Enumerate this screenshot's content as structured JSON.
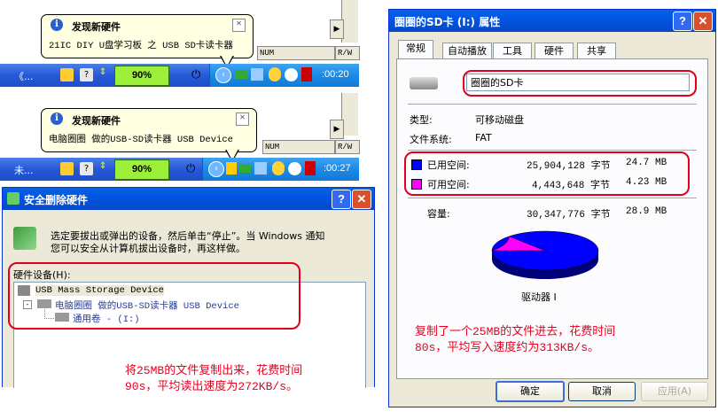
{
  "balloon1": {
    "title": "发现新硬件",
    "body": "21IC DIY U盘学习板 之 USB SD卡读卡器"
  },
  "balloon2": {
    "title": "发现新硬件",
    "body": "电脑圈圈 做的USB-SD读卡器 USB Device"
  },
  "status_cells": {
    "num": "NUM",
    "rw": "R/W"
  },
  "taskbar1": {
    "task_text": "《...",
    "battery": "90%",
    "clock": ":00:20"
  },
  "taskbar2": {
    "task_text": "未...",
    "battery": "90%",
    "clock": ":00:27"
  },
  "remove_dialog": {
    "title": "安全删除硬件",
    "instruction_line1": "选定要拔出或弹出的设备，然后单击“停止”。当 Windows  通知",
    "instruction_line2": "您可以安全从计算机拔出设备时，再这样做。",
    "hardware_label": "硬件设备(H):",
    "devices": [
      {
        "label": "USB Mass Storage Device"
      },
      {
        "label": "电脑圈圈 做的USB-SD读卡器 USB Device"
      },
      {
        "label": "通用卷 - (I:)"
      }
    ],
    "note_line1": "将25MB的文件复制出来，花费时间",
    "note_line2": "90s，平均读出速度为272KB/s。"
  },
  "props_dialog": {
    "title": "圈圈的SD卡 (I:) 属性",
    "tabs": [
      "常规",
      "自动播放",
      "工具",
      "硬件",
      "共享"
    ],
    "name_value": "圈圈的SD卡",
    "type_label": "类型:",
    "type_value": "可移动磁盘",
    "fs_label": "文件系统:",
    "fs_value": "FAT",
    "used_label": "已用空间:",
    "used_bytes": "25,904,128 字节",
    "used_mb": "24.7 MB",
    "free_label": "可用空间:",
    "free_bytes": "4,443,648 字节",
    "free_mb": "4.23 MB",
    "capacity_label": "容量:",
    "capacity_bytes": "30,347,776 字节",
    "capacity_mb": "28.9 MB",
    "drive_label": "驱动器 I",
    "used_fraction": 0.854,
    "colors": {
      "used": "#0000ff",
      "free": "#ff00ff"
    },
    "note_line1": "复制了一个25MB的文件进去，花费时间",
    "note_line2": "80s，平均写入速度约为313KB/s。",
    "ok": "确定",
    "cancel": "取消",
    "apply": "应用(A)"
  }
}
